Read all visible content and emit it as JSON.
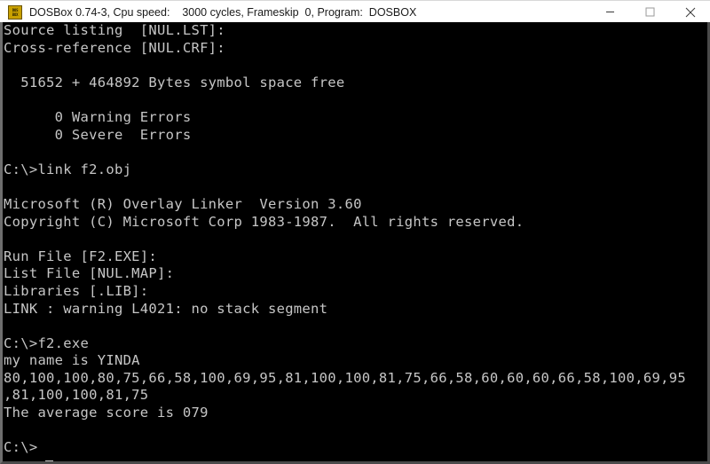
{
  "window": {
    "title": "DOSBox 0.74-3, Cpu speed:    3000 cycles, Frameskip  0, Program:  DOSBOX",
    "icon_label_top": "DOS",
    "icon_label_bottom": "BOX",
    "controls": {
      "minimize": "minimize-icon",
      "maximize": "maximize-icon",
      "close": "close-icon"
    }
  },
  "terminal": {
    "foreground_color": "#c6c6c6",
    "background_color": "#000000",
    "prompt": "C:\\>",
    "lines": [
      "Source listing  [NUL.LST]:",
      "Cross-reference [NUL.CRF]:",
      "",
      "  51652 + 464892 Bytes symbol space free",
      "",
      "      0 Warning Errors",
      "      0 Severe  Errors",
      "",
      "C:\\>link f2.obj",
      "",
      "Microsoft (R) Overlay Linker  Version 3.60",
      "Copyright (C) Microsoft Corp 1983-1987.  All rights reserved.",
      "",
      "Run File [F2.EXE]:",
      "List File [NUL.MAP]:",
      "Libraries [.LIB]:",
      "LINK : warning L4021: no stack segment",
      "",
      "C:\\>f2.exe",
      "my name is YINDA",
      "80,100,100,80,75,66,58,100,69,95,81,100,100,81,75,66,58,60,60,60,66,58,100,69,95",
      ",81,100,100,81,75",
      "The average score is 079",
      "",
      "C:\\>"
    ],
    "program_output": {
      "name_line": "my name is YINDA",
      "scores": [
        80,
        100,
        100,
        80,
        75,
        66,
        58,
        100,
        69,
        95,
        81,
        100,
        100,
        81,
        75,
        66,
        58,
        60,
        60,
        60,
        66,
        58,
        100,
        69,
        95,
        81,
        100,
        100,
        81,
        75
      ],
      "average_label": "The average score is",
      "average_value": "079"
    },
    "commands": [
      "link f2.obj",
      "f2.exe"
    ]
  }
}
